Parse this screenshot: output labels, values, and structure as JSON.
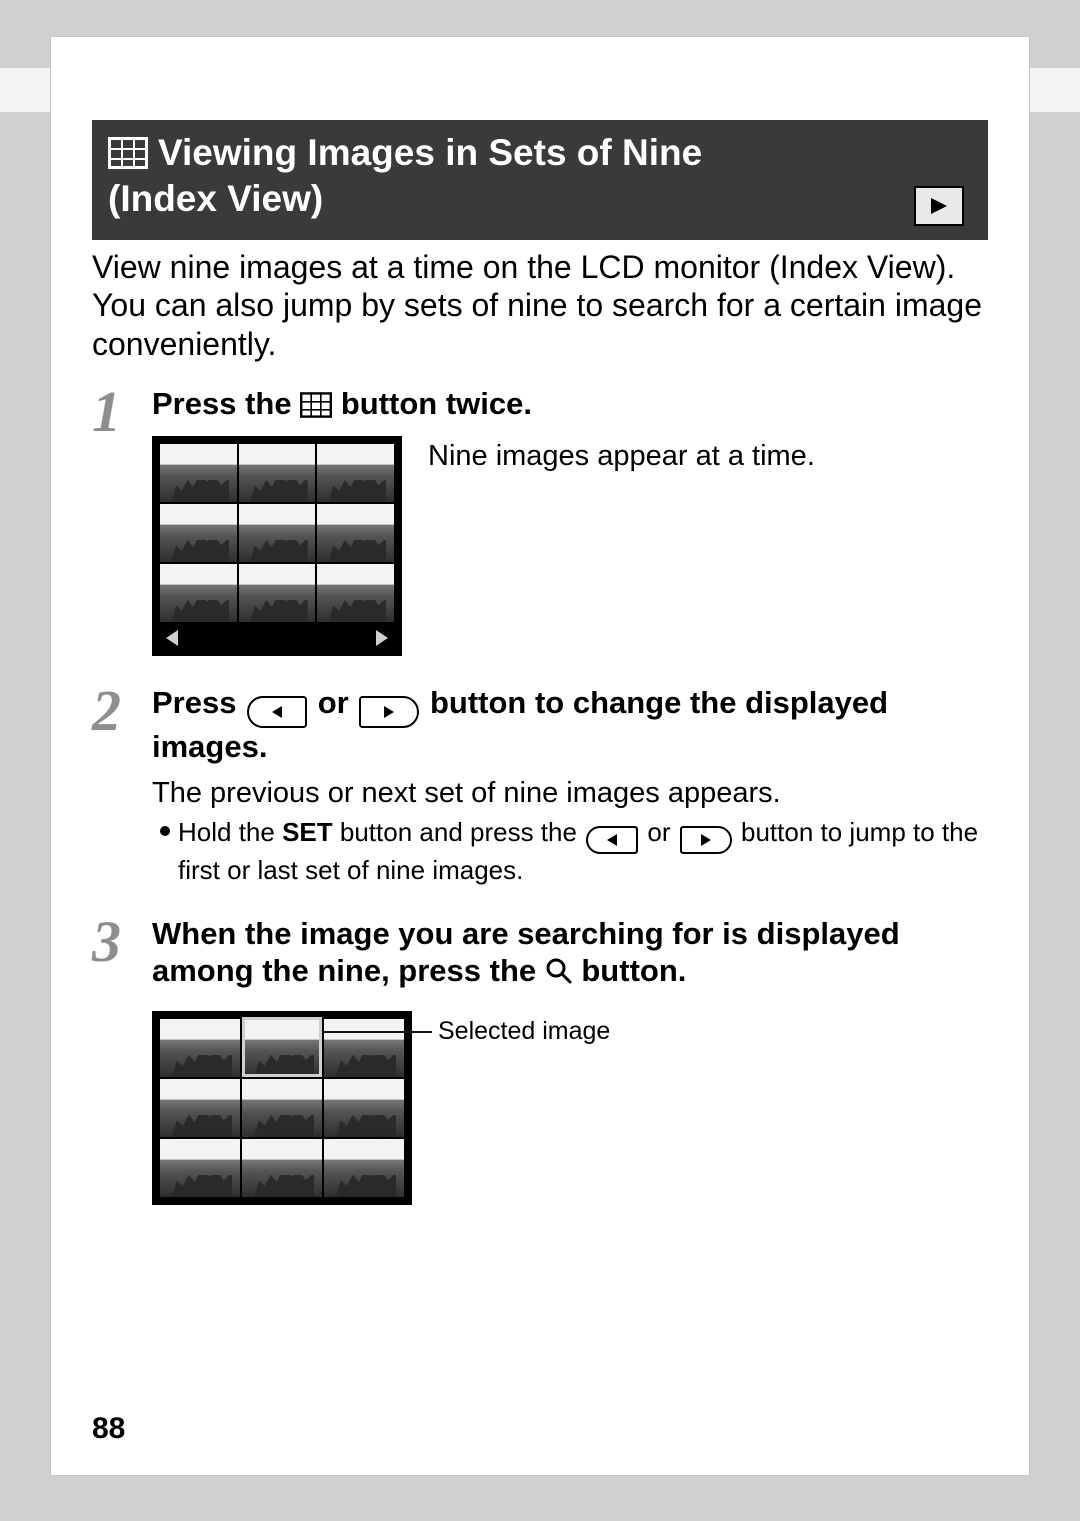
{
  "banner": {
    "title_line1": "Viewing Images in Sets of Nine",
    "title_line2": "(Index View)"
  },
  "intro": "View nine images at a time on the LCD monitor (Index View). You can also jump by sets of nine to search for a certain image conveniently.",
  "steps": {
    "s1": {
      "num": "1",
      "head_a": "Press the ",
      "head_b": " button twice.",
      "note": "Nine images appear at a time."
    },
    "s2": {
      "num": "2",
      "head_a": "Press ",
      "head_or": " or ",
      "head_b": " button to change the displayed images.",
      "para": "The previous or next set of nine images appears.",
      "bullet_a": "Hold the ",
      "bullet_set": "SET",
      "bullet_b": " button and press the ",
      "bullet_or": " or ",
      "bullet_c": " button to jump to the first or last set of nine images."
    },
    "s3": {
      "num": "3",
      "head_a": "When the image you are searching for is displayed among the nine, press the ",
      "head_b": " button."
    }
  },
  "callout_selected": "Selected image",
  "page_number": "88"
}
